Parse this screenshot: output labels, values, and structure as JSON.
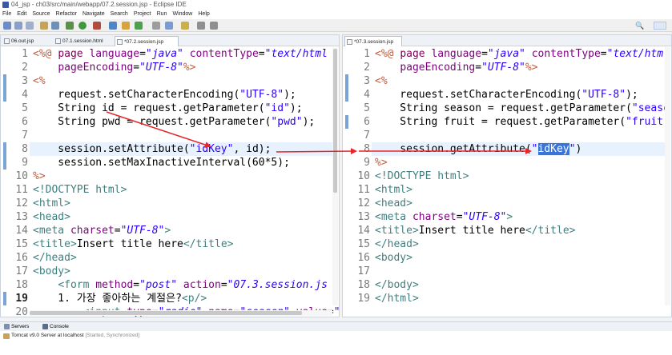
{
  "window": {
    "title": "04_jsp - ch03/src/main/webapp/07.2.session.jsp - Eclipse IDE"
  },
  "menu": [
    "File",
    "Edit",
    "Source",
    "Refactor",
    "Navigate",
    "Search",
    "Project",
    "Run",
    "Window",
    "Help"
  ],
  "toolbar": {
    "search_icon": "magnifier-icon"
  },
  "left_editor": {
    "tabs": [
      {
        "label": "06.out.jsp"
      },
      {
        "label": "07.1.session.html"
      },
      {
        "label": "*07.2.session.jsp"
      }
    ],
    "lines": [
      {
        "n": "1",
        "text": "<%@ page language=\"java\" contentType=\"text/html"
      },
      {
        "n": "2",
        "text": "    pageEncoding=\"UTF-8\"%>"
      },
      {
        "n": "3",
        "text": "<%"
      },
      {
        "n": "4",
        "text": "    request.setCharacterEncoding(\"UTF-8\");"
      },
      {
        "n": "5",
        "text": "    String id = request.getParameter(\"id\");"
      },
      {
        "n": "6",
        "text": "    String pwd = request.getParameter(\"pwd\");"
      },
      {
        "n": "7",
        "text": ""
      },
      {
        "n": "8",
        "text": "    session.setAttribute(\"idKey\", id);"
      },
      {
        "n": "9",
        "text": "    session.setMaxInactiveInterval(60*5);"
      },
      {
        "n": "10",
        "text": "%>"
      },
      {
        "n": "11",
        "text": "<!DOCTYPE html>"
      },
      {
        "n": "12",
        "text": "<html>"
      },
      {
        "n": "13",
        "text": "<head>"
      },
      {
        "n": "14",
        "text": "<meta charset=\"UTF-8\">"
      },
      {
        "n": "15",
        "text": "<title>Insert title here</title>"
      },
      {
        "n": "16",
        "text": "</head>"
      },
      {
        "n": "17",
        "text": "<body>"
      },
      {
        "n": "18",
        "text": "    <form method=\"post\" action=\"07.3.session.js"
      },
      {
        "n": "19",
        "text": "    1. 가장 좋아하는 계절은?<p/>"
      },
      {
        "n": "20",
        "text": "        <input type=\"radio\" name=\"season\" value=\""
      }
    ]
  },
  "right_editor": {
    "tabs": [
      {
        "label": "*07.3.session.jsp"
      }
    ],
    "lines": [
      {
        "n": "1",
        "text": "<%@ page language=\"java\" contentType=\"text/html"
      },
      {
        "n": "2",
        "text": "    pageEncoding=\"UTF-8\"%>"
      },
      {
        "n": "3",
        "text": "<%"
      },
      {
        "n": "4",
        "text": "    request.setCharacterEncoding(\"UTF-8\");"
      },
      {
        "n": "5",
        "text": "    String season = request.getParameter(\"seasc"
      },
      {
        "n": "6",
        "text": "    String fruit = request.getParameter(\"fruit\""
      },
      {
        "n": "7",
        "text": ""
      },
      {
        "n": "8",
        "text": "    session.getAttribute(\"idKey\")"
      },
      {
        "n": "9",
        "text": "%>"
      },
      {
        "n": "10",
        "text": "<!DOCTYPE html>"
      },
      {
        "n": "11",
        "text": "<html>"
      },
      {
        "n": "12",
        "text": "<head>"
      },
      {
        "n": "13",
        "text": "<meta charset=\"UTF-8\">"
      },
      {
        "n": "14",
        "text": "<title>Insert title here</title>"
      },
      {
        "n": "15",
        "text": "</head>"
      },
      {
        "n": "16",
        "text": "<body>"
      },
      {
        "n": "17",
        "text": ""
      },
      {
        "n": "18",
        "text": "</body>"
      },
      {
        "n": "19",
        "text": "</html>"
      }
    ]
  },
  "bottom_panel": {
    "tabs": [
      {
        "label": "Servers"
      },
      {
        "label": "Console"
      }
    ],
    "server": {
      "name": "Tomcat v9.0 Server at localhost",
      "status": "[Started, Synchronized]"
    }
  },
  "colors": {
    "annotation_arrow": "#e8262a",
    "selection": "#3875d7",
    "line_marker": "#7aa4d8"
  }
}
